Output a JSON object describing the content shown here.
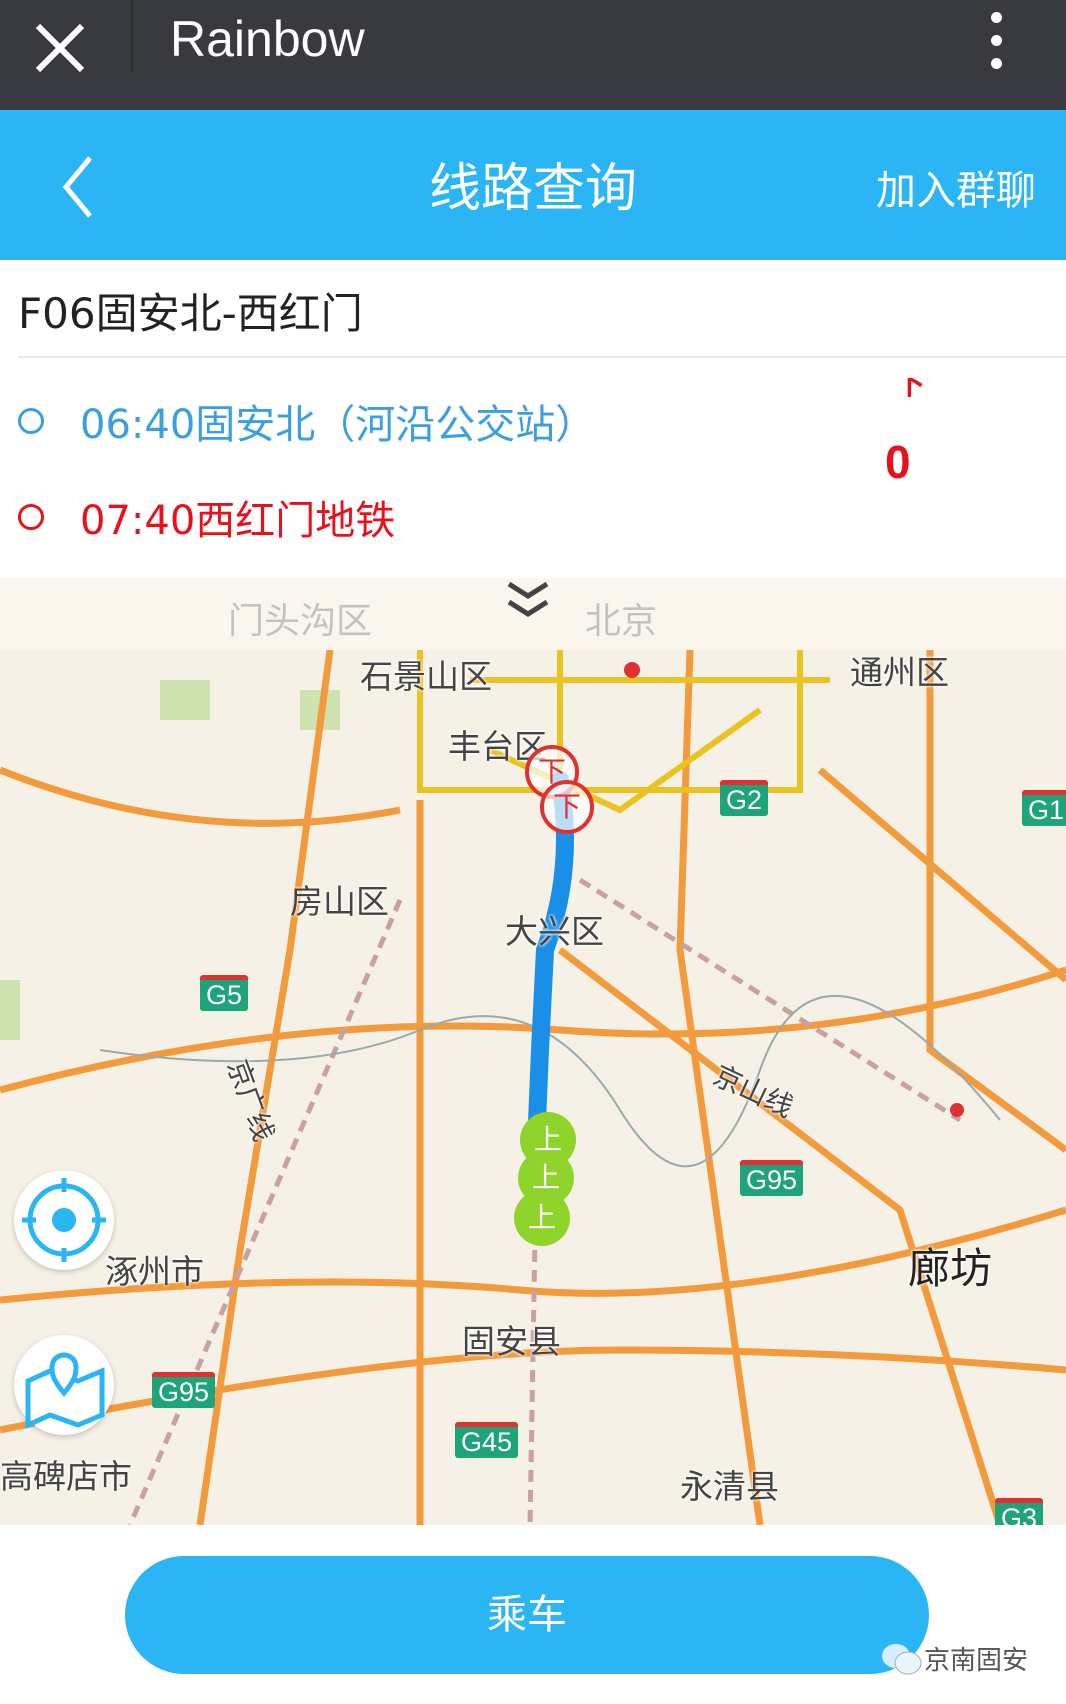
{
  "app_bar": {
    "title": "Rainbow",
    "close_icon": "close-icon",
    "more_icon": "more-vertical-icon"
  },
  "header": {
    "title": "线路查询",
    "action": "加入群聊",
    "back_icon": "chevron-left-icon",
    "bg_color": "#2bb5f5"
  },
  "route": {
    "name": "F06固安北-西红门",
    "stops": [
      {
        "time_name": "06:40固安北（河沿公交站）",
        "color": "#3a9fe0"
      },
      {
        "time_name": "07:40西红门地铁",
        "color": "#e8101a"
      }
    ],
    "alight_label": "下",
    "count": "0"
  },
  "map": {
    "labels": [
      "门头沟区",
      "北京",
      "石景山区",
      "通州区",
      "丰台区",
      "房山区",
      "大兴区",
      "涿州市",
      "固安县",
      "廊坊",
      "永清县",
      "高碑店市",
      "京山线",
      "京广线"
    ],
    "shields": [
      "G2",
      "G1",
      "G5",
      "G95",
      "G95",
      "G45",
      "G3"
    ],
    "marker_board": "上",
    "marker_alight": "下"
  },
  "ride_button": "乘车",
  "watermark": "京南固安"
}
